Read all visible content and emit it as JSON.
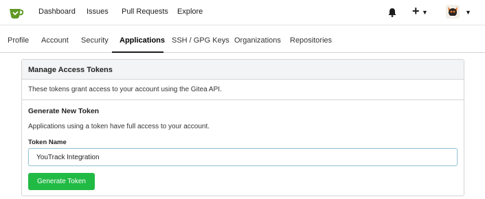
{
  "topbar": {
    "logo_icon": "gitea-teacup-icon",
    "nav": [
      {
        "label": "Dashboard"
      },
      {
        "label": "Issues"
      },
      {
        "label": "Pull Requests"
      },
      {
        "label": "Explore"
      }
    ],
    "notifications_icon": "bell-icon",
    "create_label": "+",
    "caret_icon": "caret-down-icon",
    "avatar_icon": "user-avatar"
  },
  "tabs": [
    {
      "label": "Profile"
    },
    {
      "label": "Account"
    },
    {
      "label": "Security"
    },
    {
      "label": "Applications",
      "active": true
    },
    {
      "label": "SSH / GPG Keys"
    },
    {
      "label": "Organizations"
    },
    {
      "label": "Repositories"
    }
  ],
  "panel": {
    "title": "Manage Access Tokens",
    "description": "These tokens grant access to your account using the Gitea API.",
    "section_title": "Generate New Token",
    "section_description": "Applications using a token have full access to your account.",
    "token_name_label": "Token Name",
    "token_name_value": "YouTrack Integration",
    "generate_button": "Generate Token"
  },
  "colors": {
    "brand_green": "#609926",
    "button_green": "#21ba45",
    "input_focus_border": "#96c8da",
    "header_bg": "#f3f4f5"
  }
}
